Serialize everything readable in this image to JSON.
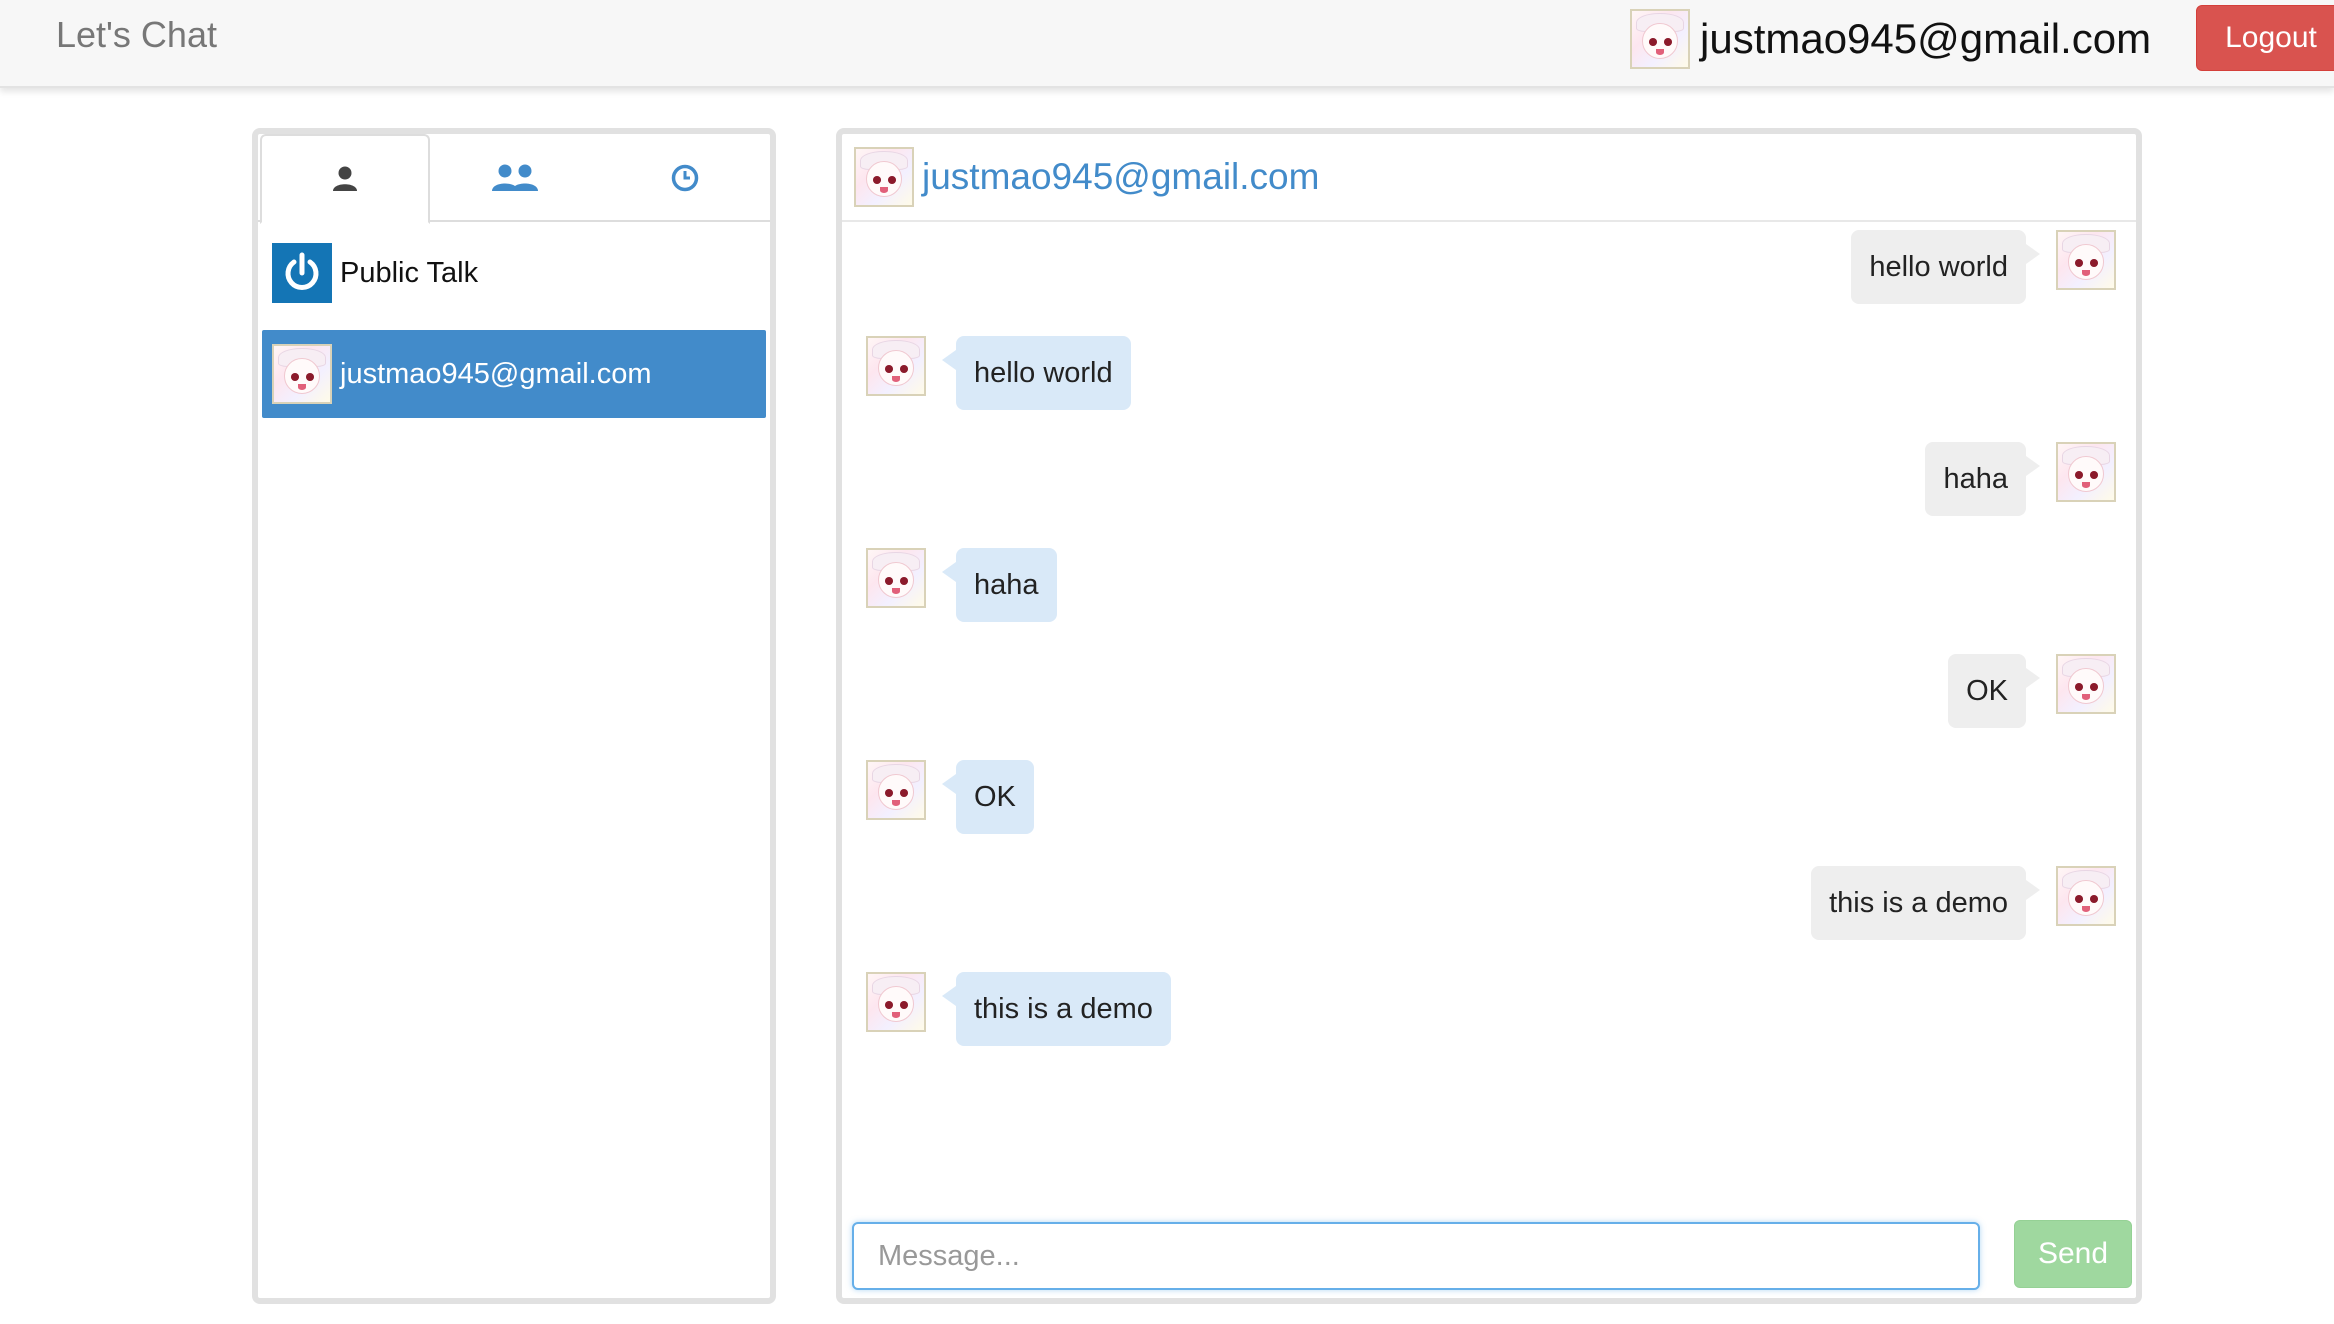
{
  "app": {
    "brand": "Let's Chat"
  },
  "navbar": {
    "user_email": "justmao945@gmail.com",
    "logout_label": "Logout",
    "logout_color": "#d9534f"
  },
  "sidebar": {
    "tabs": [
      {
        "icon": "user-icon",
        "active": true
      },
      {
        "icon": "users-icon",
        "active": false
      },
      {
        "icon": "clock-icon",
        "active": false
      }
    ],
    "contacts": [
      {
        "label": "Public Talk",
        "icon": "power-icon",
        "active": false
      },
      {
        "label": "justmao945@gmail.com",
        "icon": "avatar",
        "active": true
      }
    ],
    "active_color": "#428bca"
  },
  "chat": {
    "title": "justmao945@gmail.com",
    "messages": [
      {
        "from": "me",
        "text": "hello world"
      },
      {
        "from": "other",
        "text": "hello world"
      },
      {
        "from": "me",
        "text": "haha"
      },
      {
        "from": "other",
        "text": "haha"
      },
      {
        "from": "me",
        "text": "OK"
      },
      {
        "from": "other",
        "text": "OK"
      },
      {
        "from": "me",
        "text": "this is a demo"
      },
      {
        "from": "other",
        "text": "this is a demo"
      }
    ],
    "input": {
      "value": "",
      "placeholder": "Message..."
    },
    "send_label": "Send",
    "send_color": "#9fd89f"
  }
}
